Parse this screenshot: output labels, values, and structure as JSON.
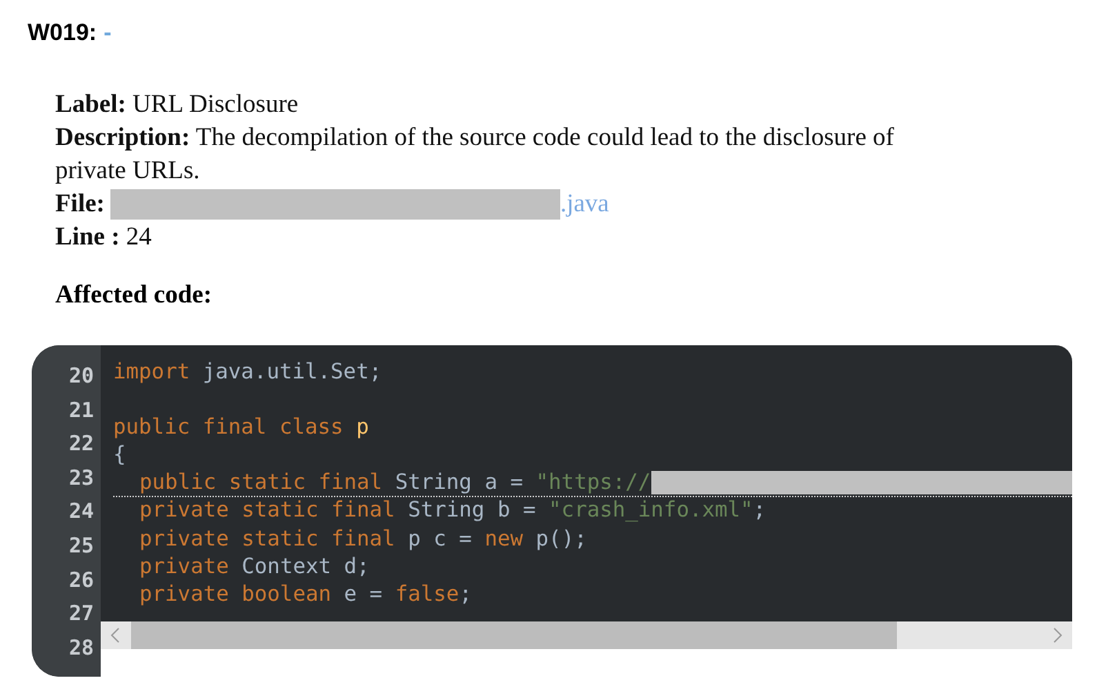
{
  "heading": {
    "code": "W019:",
    "link": "-"
  },
  "details": [
    {
      "label": "Label:",
      "value": "URL Disclosure"
    },
    {
      "label": "Description:",
      "value": "The decompilation of the source code could lead to the disclosure of private URLs."
    },
    {
      "label": "File:",
      "value": ".java",
      "redacted": true,
      "link": true
    },
    {
      "label": "Line :",
      "value": "24"
    }
  ],
  "section_title": "Affected code:",
  "code": {
    "lines": [
      {
        "number": "20",
        "highlighted": false,
        "indented": false,
        "tokens": [
          {
            "kind": "keyword",
            "text": "import"
          },
          {
            "kind": "plain",
            "text": " java.util.Set;"
          }
        ]
      },
      {
        "number": "21",
        "highlighted": false
      },
      {
        "number": "22",
        "highlighted": false,
        "indented": false,
        "tokens": [
          {
            "kind": "keyword",
            "text": "public final class"
          },
          {
            "kind": "classname",
            "text": " p"
          }
        ]
      },
      {
        "number": "23",
        "highlighted": false,
        "indented": false,
        "tokens": [
          {
            "kind": "plain",
            "text": "{"
          }
        ]
      },
      {
        "number": "24",
        "highlighted": true,
        "redacted": true,
        "indented": true,
        "tokens": [
          {
            "kind": "keyword",
            "text": "public static final"
          },
          {
            "kind": "plain",
            "text": " String a = "
          },
          {
            "kind": "string",
            "text": "\"https://"
          }
        ]
      },
      {
        "number": "25",
        "highlighted": false,
        "indented": true,
        "tokens": [
          {
            "kind": "keyword",
            "text": "private static final"
          },
          {
            "kind": "plain",
            "text": " String b = "
          },
          {
            "kind": "string",
            "text": "\"crash_info.xml\""
          },
          {
            "kind": "plain",
            "text": ";"
          }
        ]
      },
      {
        "number": "26",
        "highlighted": false,
        "indented": true,
        "tokens": [
          {
            "kind": "keyword",
            "text": "private static final"
          },
          {
            "kind": "plain",
            "text": " p c = "
          },
          {
            "kind": "keyword",
            "text": "new"
          },
          {
            "kind": "plain",
            "text": " p();"
          }
        ]
      },
      {
        "number": "27",
        "highlighted": false,
        "indented": true,
        "tokens": [
          {
            "kind": "keyword",
            "text": "private"
          },
          {
            "kind": "plain",
            "text": " Context d;"
          }
        ]
      },
      {
        "number": "28",
        "highlighted": false,
        "indented": true,
        "tokens": [
          {
            "kind": "keyword",
            "text": "private boolean"
          },
          {
            "kind": "plain",
            "text": " e = "
          },
          {
            "kind": "keyword",
            "text": "false"
          },
          {
            "kind": "plain",
            "text": ";"
          }
        ]
      }
    ]
  }
}
